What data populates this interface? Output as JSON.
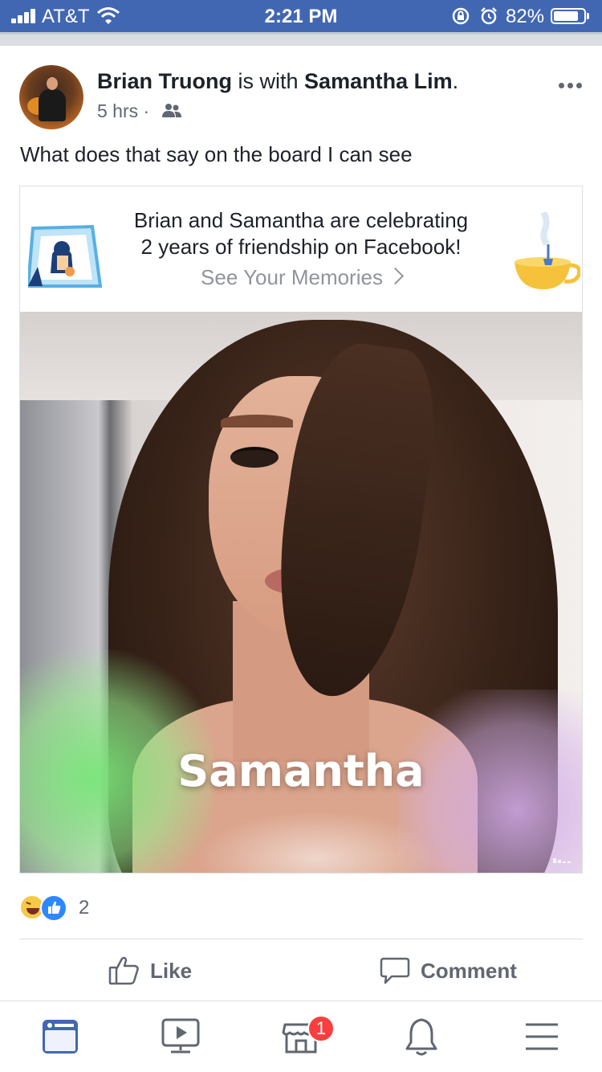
{
  "status_bar": {
    "carrier": "AT&T",
    "time": "2:21 PM",
    "battery_percent": "82%",
    "battery_level": 0.82,
    "icons": [
      "signal-icon",
      "wifi-icon",
      "rotation-lock-icon",
      "alarm-icon",
      "battery-icon"
    ]
  },
  "post": {
    "author": "Brian Truong",
    "with_text": "is with",
    "tagged": "Samantha Lim",
    "period": ".",
    "time_ago": "5 hrs",
    "separator": "·",
    "audience_icon": "friends-icon",
    "text": "What does that say on the board I can see"
  },
  "memory_card": {
    "title_line1": "Brian and Samantha are celebrating",
    "title_line2": "2 years of friendship on Facebook!",
    "link_label": "See Your Memories",
    "overlay_name": "Samantha"
  },
  "reactions": {
    "icons": [
      "haha-icon",
      "like-icon"
    ],
    "count": "2"
  },
  "actions": {
    "like_label": "Like",
    "comment_label": "Comment"
  },
  "tab_bar": {
    "tabs": [
      "news-feed-icon",
      "watch-icon",
      "marketplace-icon",
      "notifications-icon",
      "menu-icon"
    ],
    "marketplace_badge": "1",
    "active_color": "#4267b2",
    "inactive_color": "#606770"
  },
  "colors": {
    "brand": "#4267b2",
    "badge": "#fa3e3e"
  }
}
